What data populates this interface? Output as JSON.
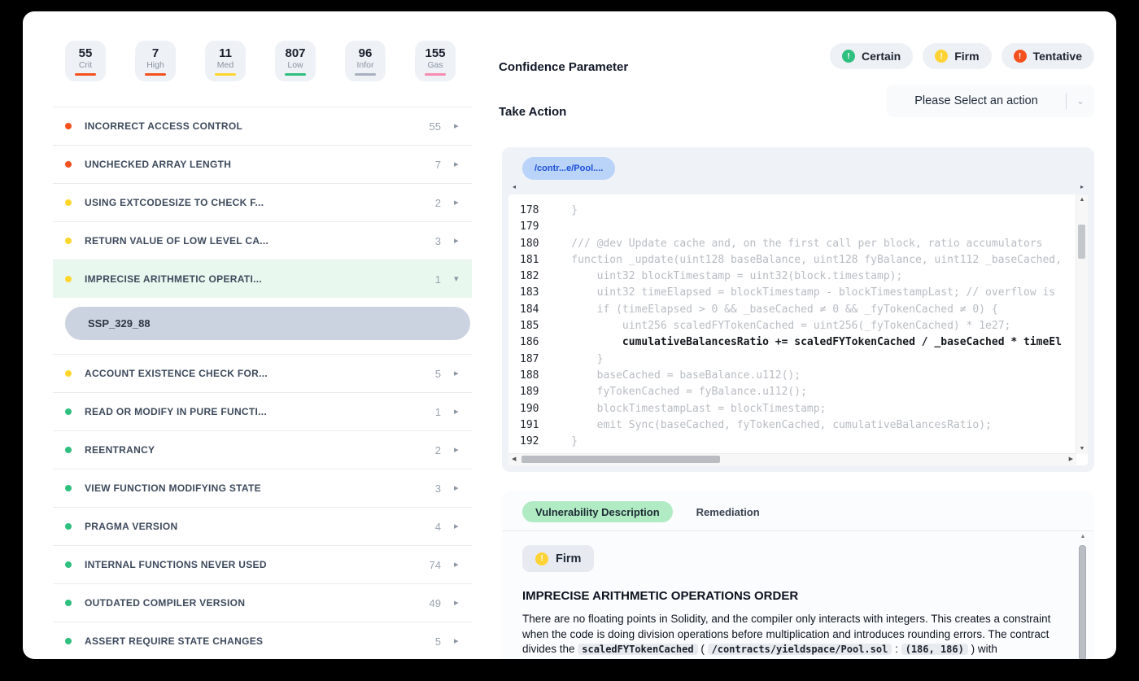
{
  "stats": [
    {
      "value": "55",
      "label": "Crit",
      "color": "#f4511e"
    },
    {
      "value": "7",
      "label": "High",
      "color": "#f4511e"
    },
    {
      "value": "11",
      "label": "Med",
      "color": "#ffd62e"
    },
    {
      "value": "807",
      "label": "Low",
      "color": "#2fbf7f"
    },
    {
      "value": "96",
      "label": "Infor",
      "color": "#a9b1bf"
    },
    {
      "value": "155",
      "label": "Gas",
      "color": "#f78cb1"
    }
  ],
  "vulnerabilities": {
    "expanded_finding_id": "SSP_329_88",
    "items": [
      {
        "label": "INCORRECT ACCESS CONTROL",
        "count": "55",
        "dot": "#f4511e",
        "state": "collapsed"
      },
      {
        "label": "UNCHECKED ARRAY LENGTH",
        "count": "7",
        "dot": "#f4511e",
        "state": "collapsed"
      },
      {
        "label": "USING EXTCODESIZE TO CHECK F...",
        "count": "2",
        "dot": "#ffd62e",
        "state": "collapsed"
      },
      {
        "label": "RETURN VALUE OF LOW LEVEL CA...",
        "count": "3",
        "dot": "#ffd62e",
        "state": "collapsed"
      },
      {
        "label": "IMPRECISE ARITHMETIC OPERATI...",
        "count": "1",
        "dot": "#ffd62e",
        "state": "expanded"
      },
      {
        "label": "ACCOUNT EXISTENCE CHECK FOR...",
        "count": "5",
        "dot": "#ffd62e",
        "state": "collapsed"
      },
      {
        "label": "READ OR MODIFY IN PURE FUNCTI...",
        "count": "1",
        "dot": "#2fbf7f",
        "state": "collapsed"
      },
      {
        "label": "REENTRANCY",
        "count": "2",
        "dot": "#2fbf7f",
        "state": "collapsed"
      },
      {
        "label": "VIEW FUNCTION MODIFYING STATE",
        "count": "3",
        "dot": "#2fbf7f",
        "state": "collapsed"
      },
      {
        "label": "PRAGMA VERSION",
        "count": "4",
        "dot": "#2fbf7f",
        "state": "collapsed"
      },
      {
        "label": "INTERNAL FUNCTIONS NEVER USED",
        "count": "74",
        "dot": "#2fbf7f",
        "state": "collapsed"
      },
      {
        "label": "OUTDATED COMPILER VERSION",
        "count": "49",
        "dot": "#2fbf7f",
        "state": "collapsed"
      },
      {
        "label": "ASSERT REQUIRE STATE CHANGES",
        "count": "5",
        "dot": "#2fbf7f",
        "state": "collapsed"
      }
    ]
  },
  "confidence": {
    "title": "Confidence Parameter",
    "badges": [
      {
        "label": "Certain",
        "color": "#2fbf7f"
      },
      {
        "label": "Firm",
        "color": "#ffd335"
      },
      {
        "label": "Tentative",
        "color": "#f4511e"
      }
    ]
  },
  "take_action": {
    "label": "Take Action",
    "placeholder": "Please Select an action"
  },
  "code_viewer": {
    "file_tab": "/contr...e/Pool....",
    "highlight_line": "186",
    "lines": [
      {
        "no": "178",
        "text": "    }"
      },
      {
        "no": "179",
        "text": ""
      },
      {
        "no": "180",
        "text": "    /// @dev Update cache and, on the first call per block, ratio accumulators"
      },
      {
        "no": "181",
        "text": "    function _update(uint128 baseBalance, uint128 fyBalance, uint112 _baseCached,"
      },
      {
        "no": "182",
        "text": "        uint32 blockTimestamp = uint32(block.timestamp);"
      },
      {
        "no": "183",
        "text": "        uint32 timeElapsed = blockTimestamp - blockTimestampLast; // overflow is"
      },
      {
        "no": "184",
        "text": "        if (timeElapsed > 0 && _baseCached ≠ 0 && _fyTokenCached ≠ 0) {"
      },
      {
        "no": "185",
        "text": "            uint256 scaledFYTokenCached = uint256(_fyTokenCached) * 1e27;"
      },
      {
        "no": "186",
        "text": "            cumulativeBalancesRatio += scaledFYTokenCached / _baseCached * timeEl",
        "hl": true
      },
      {
        "no": "187",
        "text": "        }"
      },
      {
        "no": "188",
        "text": "        baseCached = baseBalance.u112();"
      },
      {
        "no": "189",
        "text": "        fyTokenCached = fyBalance.u112();"
      },
      {
        "no": "190",
        "text": "        blockTimestampLast = blockTimestamp;"
      },
      {
        "no": "191",
        "text": "        emit Sync(baseCached, fyTokenCached, cumulativeBalancesRatio);"
      },
      {
        "no": "192",
        "text": "    }"
      }
    ]
  },
  "description": {
    "tabs": [
      {
        "label": "Vulnerability Description",
        "active": true
      },
      {
        "label": "Remediation",
        "active": false
      }
    ],
    "severity_badge": {
      "label": "Firm",
      "color": "#ffd335"
    },
    "heading": "IMPRECISE ARITHMETIC OPERATIONS ORDER",
    "paragraph": [
      {
        "t": "text",
        "v": "There are no floating points in Solidity, and the compiler only interacts with integers. This creates a constraint when the code is doing division operations before multiplication and introduces rounding errors. The contract divides the "
      },
      {
        "t": "code",
        "v": "scaledFYTokenCached"
      },
      {
        "t": "text",
        "v": " ( "
      },
      {
        "t": "code",
        "v": "/contracts/yieldspace/Pool.sol"
      },
      {
        "t": "text",
        "v": " : "
      },
      {
        "t": "code",
        "v": "(186, 186)"
      },
      {
        "t": "text",
        "v": " ) with"
      }
    ]
  }
}
